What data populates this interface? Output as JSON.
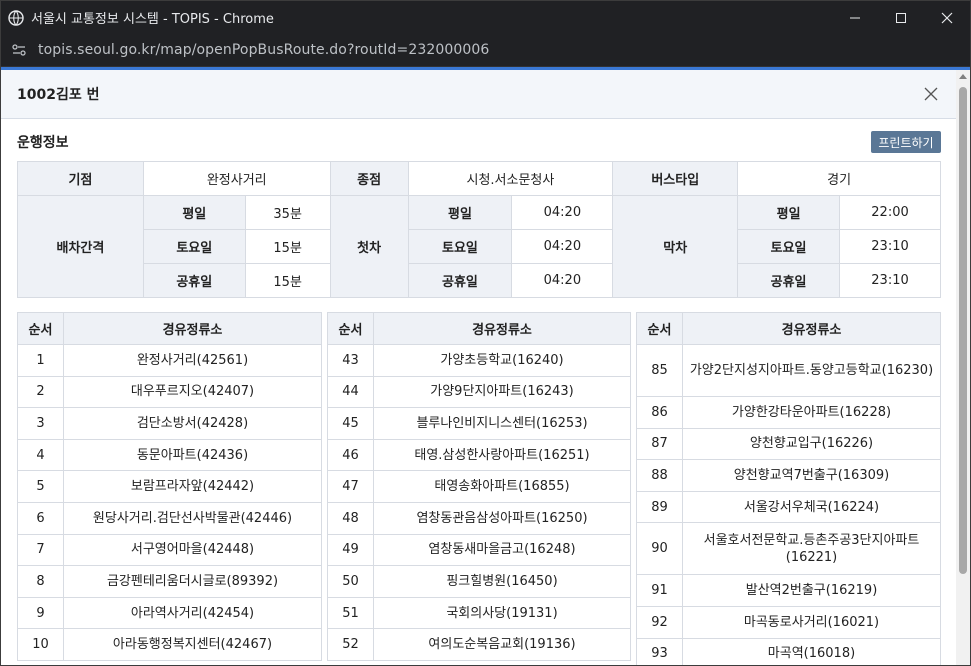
{
  "window": {
    "title": "서울시 교통정보 시스템 - TOPIS - Chrome",
    "url": "topis.seoul.go.kr/map/openPopBusRoute.do?routId=232000006"
  },
  "popup": {
    "title": "1002김포 번"
  },
  "section": {
    "title": "운행정보",
    "print_label": "프린트하기"
  },
  "info": {
    "start_label": "기점",
    "start_value": "완정사거리",
    "end_label": "종점",
    "end_value": "시청.서소문청사",
    "bustype_label": "버스타입",
    "bustype_value": "경기",
    "interval_label": "배차간격",
    "first_label": "첫차",
    "last_label": "막차",
    "day_weekday": "평일",
    "day_saturday": "토요일",
    "day_holiday": "공휴일",
    "interval": [
      "35분",
      "15분",
      "15분"
    ],
    "first": [
      "04:20",
      "04:20",
      "04:20"
    ],
    "last": [
      "22:00",
      "23:10",
      "23:10"
    ]
  },
  "stops": {
    "col_no": "순서",
    "col_name": "경유정류소",
    "col1": [
      {
        "no": "1",
        "name": "완정사거리(42561)"
      },
      {
        "no": "2",
        "name": "대우푸르지오(42407)"
      },
      {
        "no": "3",
        "name": "검단소방서(42428)"
      },
      {
        "no": "4",
        "name": "동문아파트(42436)"
      },
      {
        "no": "5",
        "name": "보람프라자앞(42442)"
      },
      {
        "no": "6",
        "name": "원당사거리.검단선사박물관(42446)"
      },
      {
        "no": "7",
        "name": "서구영어마을(42448)"
      },
      {
        "no": "8",
        "name": "금강펜테리움더시글로(89392)"
      },
      {
        "no": "9",
        "name": "아라역사거리(42454)"
      },
      {
        "no": "10",
        "name": "아라동행정복지센터(42467)"
      }
    ],
    "col2": [
      {
        "no": "43",
        "name": "가양초등학교(16240)"
      },
      {
        "no": "44",
        "name": "가양9단지아파트(16243)"
      },
      {
        "no": "45",
        "name": "블루나인비지니스센터(16253)"
      },
      {
        "no": "46",
        "name": "태영.삼성한사랑아파트(16251)"
      },
      {
        "no": "47",
        "name": "태영송화아파트(16855)"
      },
      {
        "no": "48",
        "name": "염창동관음삼성아파트(16250)"
      },
      {
        "no": "49",
        "name": "염창동새마을금고(16248)"
      },
      {
        "no": "50",
        "name": "핑크힐병원(16450)"
      },
      {
        "no": "51",
        "name": "국회의사당(19131)"
      },
      {
        "no": "52",
        "name": "여의도순복음교회(19136)"
      }
    ],
    "col3": [
      {
        "no": "85",
        "name": "가양2단지성지아파트.동양고등학교(16230)"
      },
      {
        "no": "86",
        "name": "가양한강타운아파트(16228)"
      },
      {
        "no": "87",
        "name": "양천향교입구(16226)"
      },
      {
        "no": "88",
        "name": "양천향교역7번출구(16309)"
      },
      {
        "no": "89",
        "name": "서울강서우체국(16224)"
      },
      {
        "no": "90",
        "name": "서울호서전문학교.등촌주공3단지아파트(16221)"
      },
      {
        "no": "91",
        "name": "발산역2번출구(16219)"
      },
      {
        "no": "92",
        "name": "마곡동로사거리(16021)"
      },
      {
        "no": "93",
        "name": "마곡역(16018)"
      }
    ]
  },
  "icons": {
    "app": "globe-icon",
    "site": "site-settings-icon",
    "close": "close-icon"
  },
  "colors": {
    "accent_line": "#3a78d4",
    "print_button": "#5a7796",
    "header_cell": "#eef1f6"
  }
}
